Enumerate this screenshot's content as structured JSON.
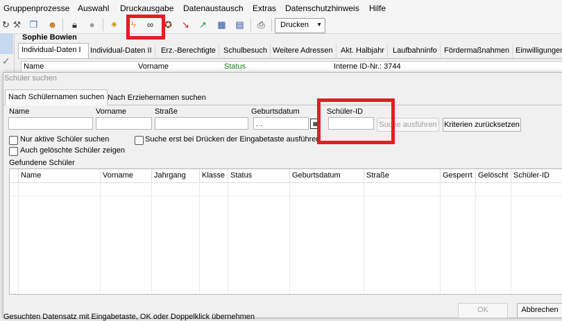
{
  "menu": [
    "Gruppenprozesse",
    "Auswahl",
    "Druckausgabe",
    "Datenaustausch",
    "Extras",
    "Datenschutzhinweis",
    "Hilfe"
  ],
  "toolbar": {
    "icons": [
      "refresh-icon",
      "tools-icon",
      "copy-icon",
      "person-icon",
      "lock-icon",
      "lock-gray-icon",
      "star-wand-icon",
      "lightning-icon",
      "binoculars-icon",
      "lifebuoy-icon",
      "chart-down-icon",
      "chart-up-icon",
      "calendar-icon",
      "form-icon",
      "printer-icon"
    ],
    "print_label": "Drucken"
  },
  "background": {
    "person_name": "Sophie Bowien",
    "tabs": [
      "Individual-Daten I",
      "Individual-Daten II",
      "Erz.-Berechtigte",
      "Schulbesuch",
      "Weitere Adressen",
      "Akt. Halbjahr",
      "Laufbahninfo",
      "Fördermaßnahmen",
      "Einwilligungen"
    ],
    "field_labels": {
      "name": "Name",
      "vorname": "Vorname",
      "status": "Status",
      "internal_id": "Interne ID-Nr.: 3744"
    }
  },
  "dialog": {
    "title": "Schüler suchen",
    "tabs": [
      "Nach Schülernamen suchen",
      "Nach Erziehernamen suchen"
    ],
    "fields": {
      "name_label": "Name",
      "vorname_label": "Vorname",
      "strasse_label": "Straße",
      "geburtsdatum_label": "Geburtsdatum",
      "geburtsdatum_value": " .  .",
      "schueler_id_label": "Schüler-ID"
    },
    "buttons": {
      "search": "Suche ausführen",
      "reset": "Kriterien zurücksetzen",
      "ok": "OK",
      "cancel": "Abbrechen"
    },
    "checkboxes": {
      "active_only": "Nur aktive Schüler suchen",
      "show_deleted": "Auch gelöschte Schüler zeigen",
      "search_on_enter": "Suche erst bei Drücken der Eingabetaste ausführen"
    },
    "results_label": "Gefundene Schüler",
    "columns": [
      "Name",
      "Vorname",
      "Jahrgang",
      "Klasse",
      "Status",
      "Geburtsdatum",
      "Straße",
      "Gesperrt",
      "Gelöscht",
      "Schüler-ID"
    ],
    "status_hint": "Gesuchten Datensatz mit Eingabetaste, OK oder Doppelklick übernehmen"
  },
  "colors": {
    "highlight": "#e51c23",
    "status_label": "#1a7a1a"
  }
}
